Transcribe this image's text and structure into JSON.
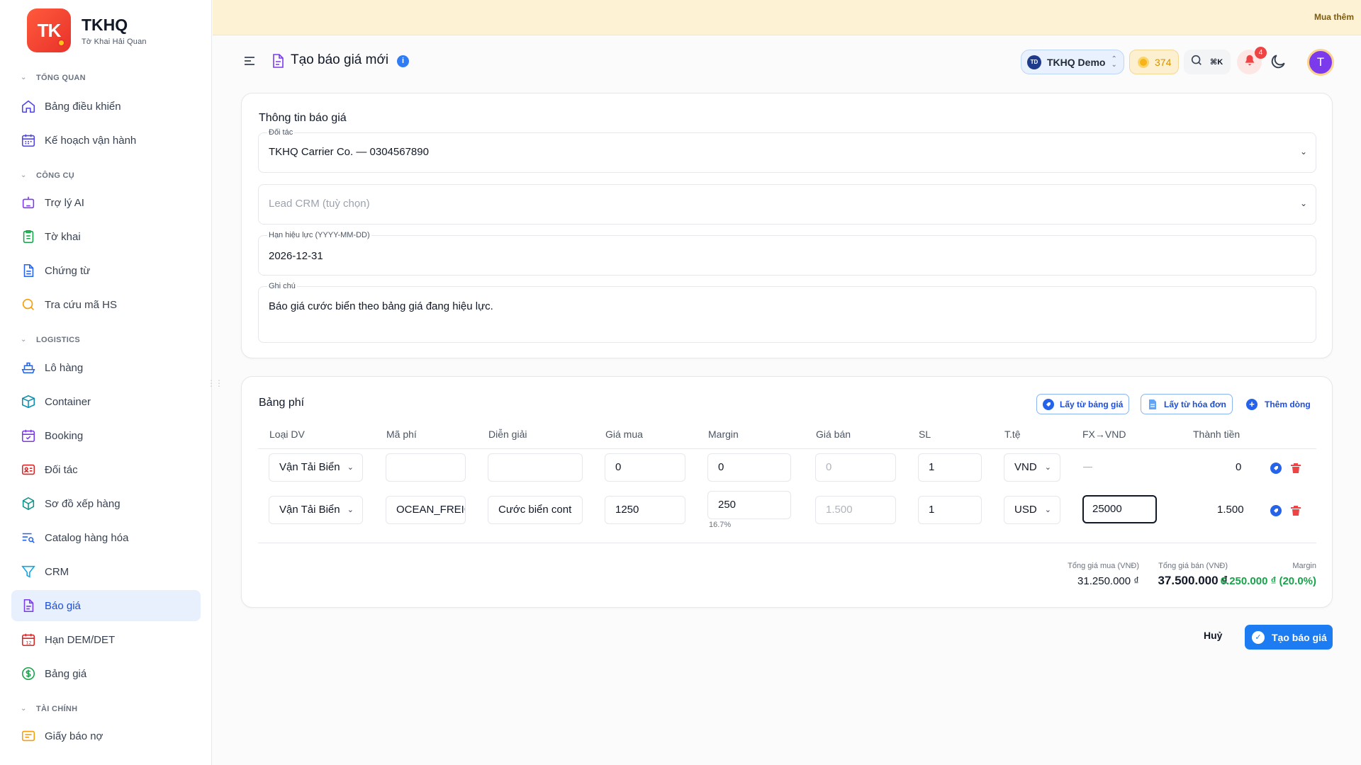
{
  "brand": {
    "logo_text": "TK",
    "name": "TKHQ",
    "subtitle": "Tờ Khai Hải Quan"
  },
  "sidebar": {
    "groups": [
      {
        "title": "TỔNG QUAN",
        "items": [
          {
            "label": "Bảng điều khiển",
            "icon": "home-icon"
          },
          {
            "label": "Kế hoạch vận hành",
            "icon": "calendar-grid-icon"
          }
        ]
      },
      {
        "title": "CÔNG CỤ",
        "items": [
          {
            "label": "Trợ lý AI",
            "icon": "robot-icon"
          },
          {
            "label": "Tờ khai",
            "icon": "clipboard-icon"
          },
          {
            "label": "Chứng từ",
            "icon": "document-icon"
          },
          {
            "label": "Tra cứu mã HS",
            "icon": "search-icon"
          }
        ]
      },
      {
        "title": "LOGISTICS",
        "items": [
          {
            "label": "Lô hàng",
            "icon": "ship-icon"
          },
          {
            "label": "Container",
            "icon": "box-icon"
          },
          {
            "label": "Booking",
            "icon": "calendar-check-icon"
          },
          {
            "label": "Đối tác",
            "icon": "id-card-icon"
          },
          {
            "label": "Sơ đồ xếp hàng",
            "icon": "cube-icon"
          },
          {
            "label": "Catalog hàng hóa",
            "icon": "list-search-icon"
          },
          {
            "label": "CRM",
            "icon": "funnel-icon"
          },
          {
            "label": "Báo giá",
            "icon": "quote-document-icon",
            "active": true
          },
          {
            "label": "Hạn DEM/DET",
            "icon": "calendar-12-icon"
          },
          {
            "label": "Bảng giá",
            "icon": "dollar-circle-icon"
          }
        ]
      },
      {
        "title": "TÀI CHÍNH",
        "items": [
          {
            "label": "Giấy báo nợ",
            "icon": "receipt-icon"
          }
        ]
      }
    ]
  },
  "banner": {
    "buy_more": "Mua thêm"
  },
  "header": {
    "title": "Tạo báo giá mới",
    "workspace_badge": "TD",
    "workspace_name": "TKHQ Demo",
    "credits": "374",
    "search_shortcut": "⌘K",
    "notifications_count": "4",
    "avatar_initial": "T"
  },
  "quote_info": {
    "title": "Thông tin báo giá",
    "partner": {
      "label": "Đối tác",
      "value": "TKHQ Carrier Co. — 0304567890"
    },
    "lead": {
      "placeholder": "Lead CRM (tuỳ chọn)"
    },
    "valid_until": {
      "label": "Hạn hiệu lực (YYYY-MM-DD)",
      "value": "2026-12-31"
    },
    "note": {
      "label": "Ghi chú",
      "value": "Báo giá cước biển theo bảng giá đang hiệu lực."
    }
  },
  "fees": {
    "title": "Bảng phí",
    "btn_from_pricelist": "Lấy từ bảng giá",
    "btn_from_invoice": "Lấy từ hóa đơn",
    "btn_add_row": "Thêm dòng",
    "columns": [
      "Loại DV",
      "Mã phí",
      "Diễn giải",
      "Giá mua",
      "Margin",
      "Giá bán",
      "SL",
      "T.tệ",
      "FX→VND",
      "Thành tiền"
    ],
    "rows": [
      {
        "service": "Vận Tải Biển",
        "code": "",
        "desc": "",
        "buy": "0",
        "margin": "0",
        "margin_pct": "",
        "sell": "0",
        "qty": "1",
        "currency": "VND",
        "fx": "—",
        "amount": "0"
      },
      {
        "service": "Vận Tải Biển",
        "code": "OCEAN_FREIGHT",
        "desc": "Cước biển cont",
        "buy": "1250",
        "margin": "250",
        "margin_pct": "16.7%",
        "sell": "1.500",
        "qty": "1",
        "currency": "USD",
        "fx": "25000",
        "amount": "1.500"
      }
    ],
    "totals": {
      "buy_label": "Tổng giá mua (VNĐ)",
      "buy_value": "31.250.000 ₫",
      "sell_label": "Tổng giá bán (VNĐ)",
      "sell_value": "37.500.000 ₫",
      "margin_label": "Margin",
      "margin_value": "6.250.000 ₫ (20.0%)"
    }
  },
  "actions": {
    "cancel": "Huỷ",
    "submit": "Tạo báo giá"
  },
  "colors": {
    "accent": "#1d7cf2",
    "active_bg": "#e8effd",
    "margin_green": "#16a34a",
    "danger": "#ef4444"
  }
}
